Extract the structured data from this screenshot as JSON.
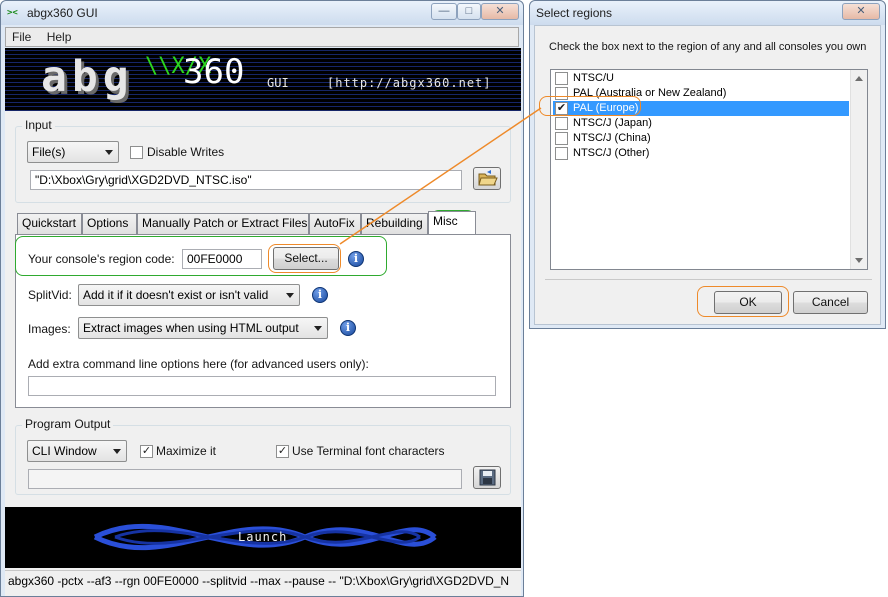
{
  "main_window": {
    "title": "abgx360 GUI",
    "menu": [
      "File",
      "Help"
    ],
    "banner": {
      "logo": "abg",
      "logo_x": "\\\\X/X",
      "logo_360": "360",
      "gui": "GUI",
      "url": "[http://abgx360.net]"
    },
    "input": {
      "group_label": "Input",
      "source_type": "File(s)",
      "disable_writes_label": "Disable Writes",
      "disable_writes_checked": false,
      "path": "\"D:\\Xbox\\Gry\\grid\\XGD2DVD_NTSC.iso\""
    },
    "tabs": [
      "Quickstart",
      "Options",
      "Manually Patch or Extract Files",
      "AutoFix",
      "Rebuilding",
      "Misc"
    ],
    "active_tab": "Misc",
    "misc": {
      "region_label": "Your console's region code:",
      "region_code": "00FE0000",
      "select_button": "Select...",
      "splitvid_label": "SplitVid:",
      "splitvid_value": "Add it if it doesn't exist or isn't valid",
      "images_label": "Images:",
      "images_value": "Extract images when using HTML output",
      "extra_label": "Add extra command line options here (for advanced users only):",
      "extra_value": ""
    },
    "program_output": {
      "group_label": "Program Output",
      "mode": "CLI Window",
      "maximize_label": "Maximize it",
      "maximize_checked": true,
      "terminal_label": "Use Terminal font characters",
      "terminal_checked": true,
      "output_path": ""
    },
    "launch_label": "Launch",
    "status": "abgx360 -pctx --af3 --rgn 00FE0000 --splitvid --max --pause -- \"D:\\Xbox\\Gry\\grid\\XGD2DVD_N"
  },
  "dialog": {
    "title": "Select regions",
    "instruction": "Check the box next to the region of any and all consoles you own",
    "regions": [
      {
        "label": "NTSC/U",
        "checked": false,
        "selected": false
      },
      {
        "label": "PAL (Australia or New Zealand)",
        "checked": false,
        "selected": false
      },
      {
        "label": "PAL (Europe)",
        "checked": true,
        "selected": true
      },
      {
        "label": "NTSC/J (Japan)",
        "checked": false,
        "selected": false
      },
      {
        "label": "NTSC/J (China)",
        "checked": false,
        "selected": false
      },
      {
        "label": "NTSC/J (Other)",
        "checked": false,
        "selected": false
      }
    ],
    "ok_label": "OK",
    "cancel_label": "Cancel"
  },
  "colors": {
    "annotation_orange": "#ee8a2a",
    "annotation_green": "#2faa2f",
    "selection_blue": "#3399ff",
    "logo_green": "#2cd61e",
    "launch_blue": "#2a4fd8"
  },
  "icons": {
    "app_icon": "abgx-icon",
    "browse_icon": "folder-open-icon",
    "save_icon": "floppy-disk-icon",
    "info_icon": "info-icon"
  }
}
